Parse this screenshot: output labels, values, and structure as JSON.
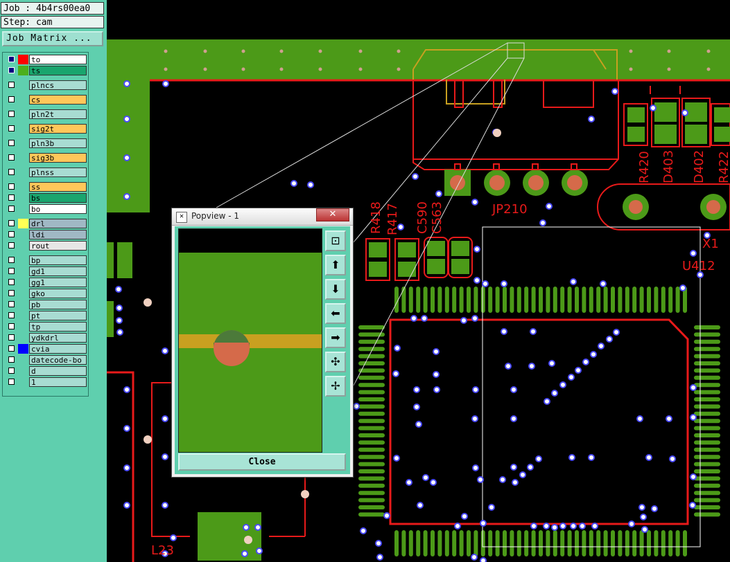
{
  "job": {
    "label": "Job : 4b4rs00ea0"
  },
  "step": {
    "label": "Step: cam"
  },
  "job_matrix_button": "Job Matrix ...",
  "layers": [
    {
      "name": "to",
      "color": "#ff0000",
      "bg": "#ffffff",
      "active": true
    },
    {
      "name": "ts",
      "color": "#4caf1c",
      "bg": "#1aa56e",
      "active": true
    },
    {
      "name": "plncs",
      "color": "",
      "bg": "#a8dcd2"
    },
    {
      "name": "cs",
      "color": "",
      "bg": "#ffc75a"
    },
    {
      "name": "pln2t",
      "color": "",
      "bg": "#a8dcd2"
    },
    {
      "name": "sig2t",
      "color": "",
      "bg": "#ffc75a"
    },
    {
      "name": "pln3b",
      "color": "",
      "bg": "#a8dcd2"
    },
    {
      "name": "sig3b",
      "color": "",
      "bg": "#ffc75a"
    },
    {
      "name": "plnss",
      "color": "",
      "bg": "#a8dcd2"
    },
    {
      "name": "ss",
      "color": "",
      "bg": "#ffc75a"
    },
    {
      "name": "bs",
      "color": "",
      "bg": "#1aa56e"
    },
    {
      "name": "bo",
      "color": "",
      "bg": "#ffffff"
    },
    {
      "name": "drl",
      "color": "#ffff55",
      "bg": "#a0b8c4"
    },
    {
      "name": "ldi",
      "color": "",
      "bg": "#a0b8c4"
    },
    {
      "name": "rout",
      "color": "",
      "bg": "#e6e6e6"
    },
    {
      "name": "bp",
      "color": "",
      "bg": "#a8dcd2"
    },
    {
      "name": "gd1",
      "color": "",
      "bg": "#a8dcd2"
    },
    {
      "name": "gg1",
      "color": "",
      "bg": "#a8dcd2"
    },
    {
      "name": "gko",
      "color": "",
      "bg": "#a8dcd2"
    },
    {
      "name": "pb",
      "color": "",
      "bg": "#a8dcd2"
    },
    {
      "name": "pt",
      "color": "",
      "bg": "#a8dcd2"
    },
    {
      "name": "tp",
      "color": "",
      "bg": "#a8dcd2"
    },
    {
      "name": "ydkdrl",
      "color": "",
      "bg": "#a8dcd2"
    },
    {
      "name": "cvia",
      "color": "#0000ff",
      "bg": "#a8dcd2"
    },
    {
      "name": "datecode-bo",
      "color": "",
      "bg": "#a8dcd2"
    },
    {
      "name": "d",
      "color": "",
      "bg": "#a8dcd2"
    },
    {
      "name": "1",
      "color": "",
      "bg": "#a8dcd2"
    }
  ],
  "pcb": {
    "labels": [
      "JP210",
      "R418",
      "R417",
      "C590",
      "C563",
      "R420",
      "D403",
      "D402",
      "R422",
      "X1",
      "U412",
      "L23"
    ],
    "colors": {
      "copper": "#4c9a18",
      "outline": "#e81a1a",
      "via": "#4a4aff",
      "silk": "#c8a020"
    }
  },
  "popview": {
    "title": "Popview - 1",
    "close_x": "✕",
    "close_button": "Close",
    "tools": [
      "zoom-fit-icon",
      "pan-up-icon",
      "pan-down-icon",
      "pan-left-icon",
      "pan-right-icon",
      "zoom-in-icon",
      "zoom-out-icon"
    ]
  }
}
